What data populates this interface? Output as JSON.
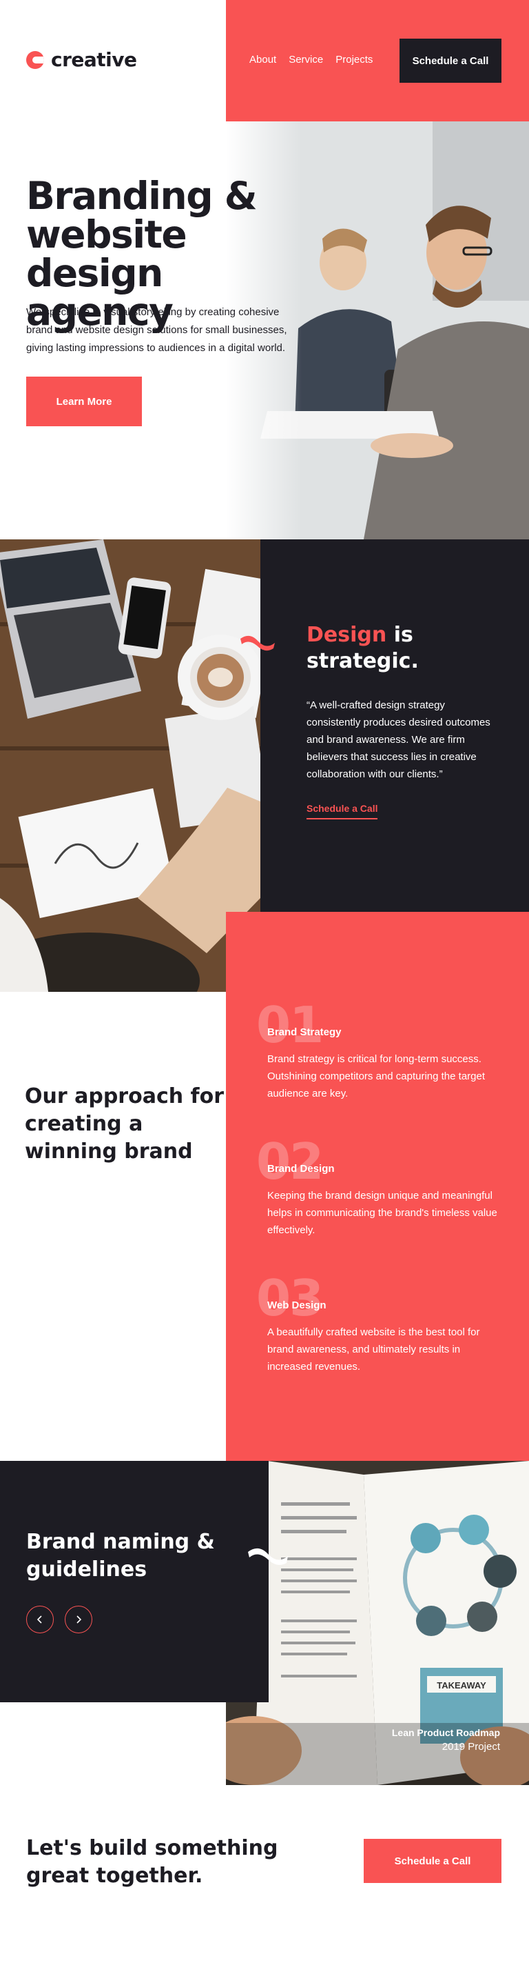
{
  "header": {
    "logo_text": "creative",
    "nav": [
      "About",
      "Service",
      "Projects"
    ],
    "cta_label": "Schedule a Call"
  },
  "hero": {
    "title": "Branding & website design agency",
    "description": "We specialize in visual storytelling by creating cohesive brand and website design solutions for small businesses, giving lasting impressions to audiences in a digital world.",
    "button_label": "Learn More"
  },
  "design": {
    "title_accent": "Design",
    "title_rest": "is strategic.",
    "quote": "“A well-crafted design strategy consistently produces desired outcomes and brand awareness. We are firm believers that success lies in creative collaboration with our clients.”",
    "link_label": "Schedule a Call"
  },
  "approach": {
    "title": "Our approach for creating a winning brand",
    "steps": [
      {
        "number": "01",
        "title": "Brand Strategy",
        "description": "Brand strategy is critical for long-term success. Outshining competitors and capturing the target audience are key."
      },
      {
        "number": "02",
        "title": "Brand Design",
        "description": "Keeping the brand design unique and meaningful helps in communicating the brand's timeless value effectively."
      },
      {
        "number": "03",
        "title": "Web Design",
        "description": "A beautifully crafted website is the best tool for brand awareness, and ultimately results in increased revenues."
      }
    ]
  },
  "brand_naming": {
    "title": "Brand naming & guidelines",
    "prev_icon": "chevron-left-icon",
    "next_icon": "chevron-right-icon",
    "caption_title": "Lean Product Roadmap",
    "caption_subtitle": "2019 Project",
    "book_text_1": "TAKEAWAY"
  },
  "cta": {
    "title": "Let's build something great together.",
    "button_label": "Schedule a Call"
  },
  "colors": {
    "accent": "#f95353",
    "dark": "#1d1c23",
    "white": "#ffffff"
  }
}
